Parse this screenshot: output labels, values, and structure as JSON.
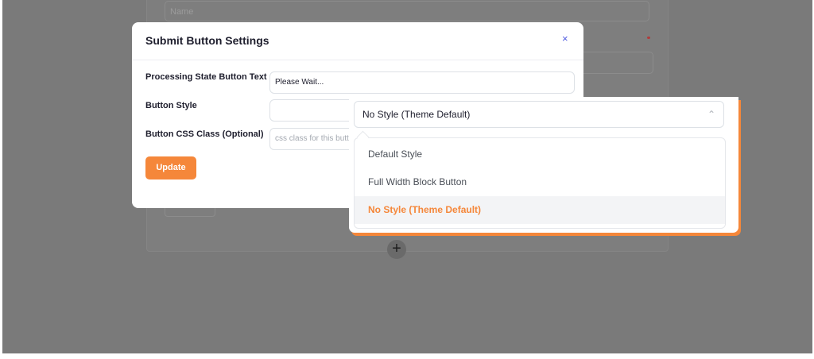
{
  "background": {
    "name_placeholder": "Name"
  },
  "modal": {
    "title": "Submit Button Settings",
    "close_glyph": "×",
    "fields": {
      "processing_label": "Processing State Button Text",
      "processing_value": "Please Wait...",
      "style_label": "Button Style",
      "css_label": "Button CSS Class (Optional)",
      "css_placeholder": "css class for this button"
    },
    "update_label": "Update"
  },
  "dropdown": {
    "selected_value": "No Style (Theme Default)",
    "chevron_icon": "chevron-up-icon",
    "options": [
      {
        "label": "Default Style"
      },
      {
        "label": "Full Width Block Button"
      },
      {
        "label": "No Style (Theme Default)"
      }
    ]
  },
  "colors": {
    "accent": "#f5873a",
    "close": "#4f5be0",
    "overlay": "#7a7a7a"
  },
  "add_glyph": "+"
}
